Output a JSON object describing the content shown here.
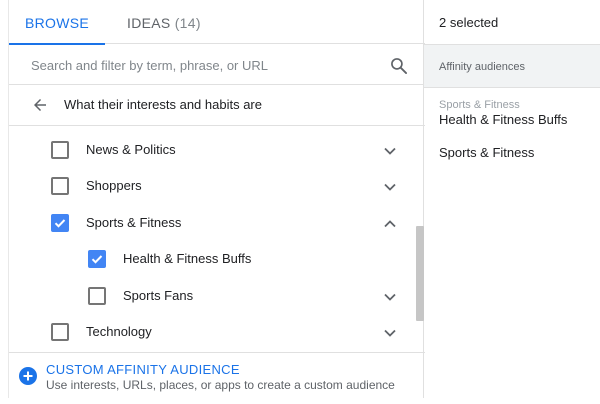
{
  "tabs": {
    "browse_label": "Browse",
    "ideas_label": "Ideas",
    "ideas_count": "(14)"
  },
  "search": {
    "placeholder": "Search and filter by term, phrase, or URL",
    "icon": "search-icon"
  },
  "breadcrumb": {
    "label": "What their interests and habits are",
    "icon": "arrow-back-icon"
  },
  "list": {
    "items": [
      {
        "label": "News & Politics",
        "checked": false,
        "expanded": false,
        "level": 0
      },
      {
        "label": "Shoppers",
        "checked": false,
        "expanded": false,
        "level": 0
      },
      {
        "label": "Sports & Fitness",
        "checked": true,
        "expanded": true,
        "level": 0
      },
      {
        "label": "Health & Fitness Buffs",
        "checked": true,
        "expanded": false,
        "level": 1
      },
      {
        "label": "Sports Fans",
        "checked": false,
        "expanded": false,
        "level": 1
      },
      {
        "label": "Technology",
        "checked": false,
        "expanded": false,
        "level": 0
      }
    ]
  },
  "custom": {
    "title": "Custom Affinity Audience",
    "description": "Use interests, URLs, places, or apps to create a custom audience",
    "icon": "add-circle-icon"
  },
  "selection": {
    "count_label": "2 selected",
    "section_header": "Affinity audiences",
    "items": [
      {
        "parent": "Sports & Fitness",
        "label": "Health & Fitness Buffs"
      },
      {
        "parent": "",
        "label": "Sports & Fitness"
      }
    ]
  },
  "colors": {
    "accent": "#1a73e8",
    "checkbox": "#4285f4",
    "divider": "#e0e0e0"
  }
}
